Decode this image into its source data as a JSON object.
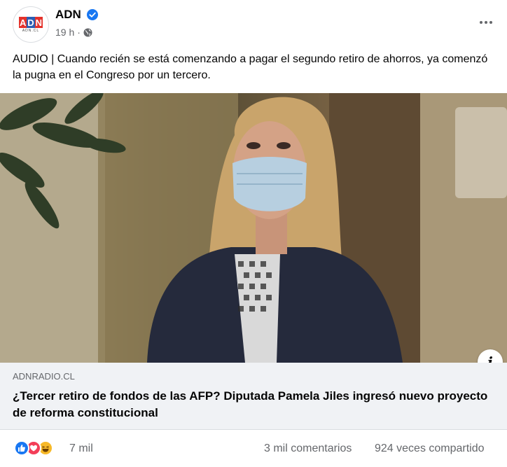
{
  "post": {
    "page_name": "ADN",
    "avatar_logo": {
      "letters": [
        "A",
        "D",
        "N"
      ],
      "subtitle": "ADN.CL",
      "colors": [
        "#e4322b",
        "#2c5fb3",
        "#e4322b"
      ]
    },
    "timestamp": "19 h",
    "separator": "·",
    "privacy_icon": "globe-icon",
    "verified_icon": "verified-badge-icon",
    "more_icon": "more-options-icon",
    "text": "AUDIO | Cuando recién se está comenzando a pagar el segundo retiro de ahorros, ya comenzó la pugna en el Congreso por un tercero."
  },
  "link_preview": {
    "domain": "ADNRADIO.CL",
    "title": "¿Tercer retiro de fondos de las AFP? Diputada Pamela Jiles ingresó nuevo proyecto de reforma constitucional",
    "info_label": "i"
  },
  "footer": {
    "reactions": [
      "like",
      "love",
      "haha"
    ],
    "reaction_count": "7 mil",
    "comments": "3 mil comentarios",
    "shares": "924 veces compartido"
  },
  "colors": {
    "brand_blue": "#1877f2",
    "secondary_text": "#65676b",
    "link_bg": "#f0f2f5"
  }
}
